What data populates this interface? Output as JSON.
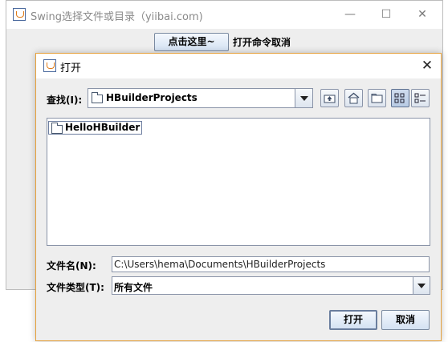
{
  "main_window": {
    "title": "Swing选择文件或目录（yiibai.com)",
    "action_button_label": "点击这里~",
    "status_text": "打开命令取消",
    "minimize_glyph": "—",
    "maximize_glyph": "☐",
    "close_glyph": "✕"
  },
  "dialog": {
    "title": "打开",
    "close_glyph": "✕",
    "look_in_label": "查找(I):",
    "look_in_value": "HBuilderProjects",
    "toolbar": [
      "up-one-level-icon",
      "home-icon",
      "new-folder-icon",
      "list-view-icon",
      "details-view-icon"
    ],
    "files": [
      {
        "name": "HelloHBuilder",
        "type": "folder"
      }
    ],
    "file_name_label": "文件名(N):",
    "file_name_value": "C:\\Users\\hema\\Documents\\HBuilderProjects",
    "file_type_label": "文件类型(T):",
    "file_type_value": "所有文件",
    "open_button": "打开",
    "cancel_button": "取消"
  },
  "colors": {
    "dialog_border": "#e5a13d",
    "panel_bg": "#eeeeee",
    "button_border": "#7a8aa0"
  }
}
